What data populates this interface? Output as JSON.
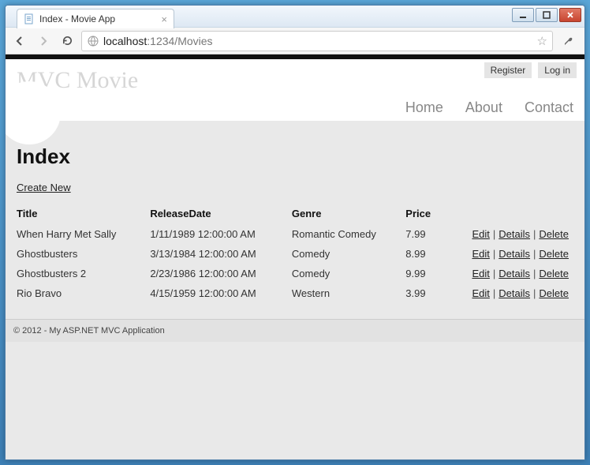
{
  "window": {
    "tab_title": "Index - Movie App",
    "url_host": "localhost",
    "url_port_path": ":1234/Movies"
  },
  "header": {
    "brand": "MVC Movie",
    "auth": {
      "register": "Register",
      "login": "Log in"
    },
    "nav": {
      "home": "Home",
      "about": "About",
      "contact": "Contact"
    }
  },
  "page": {
    "heading": "Index",
    "create_link": "Create New",
    "columns": {
      "title": "Title",
      "release": "ReleaseDate",
      "genre": "Genre",
      "price": "Price"
    },
    "actions": {
      "edit": "Edit",
      "details": "Details",
      "delete": "Delete"
    },
    "rows": [
      {
        "title": "When Harry Met Sally",
        "release": "1/11/1989 12:00:00 AM",
        "genre": "Romantic Comedy",
        "price": "7.99"
      },
      {
        "title": "Ghostbusters",
        "release": "3/13/1984 12:00:00 AM",
        "genre": "Comedy",
        "price": "8.99"
      },
      {
        "title": "Ghostbusters 2",
        "release": "2/23/1986 12:00:00 AM",
        "genre": "Comedy",
        "price": "9.99"
      },
      {
        "title": "Rio Bravo",
        "release": "4/15/1959 12:00:00 AM",
        "genre": "Western",
        "price": "3.99"
      }
    ]
  },
  "footer": {
    "text": "© 2012 - My ASP.NET MVC Application"
  }
}
